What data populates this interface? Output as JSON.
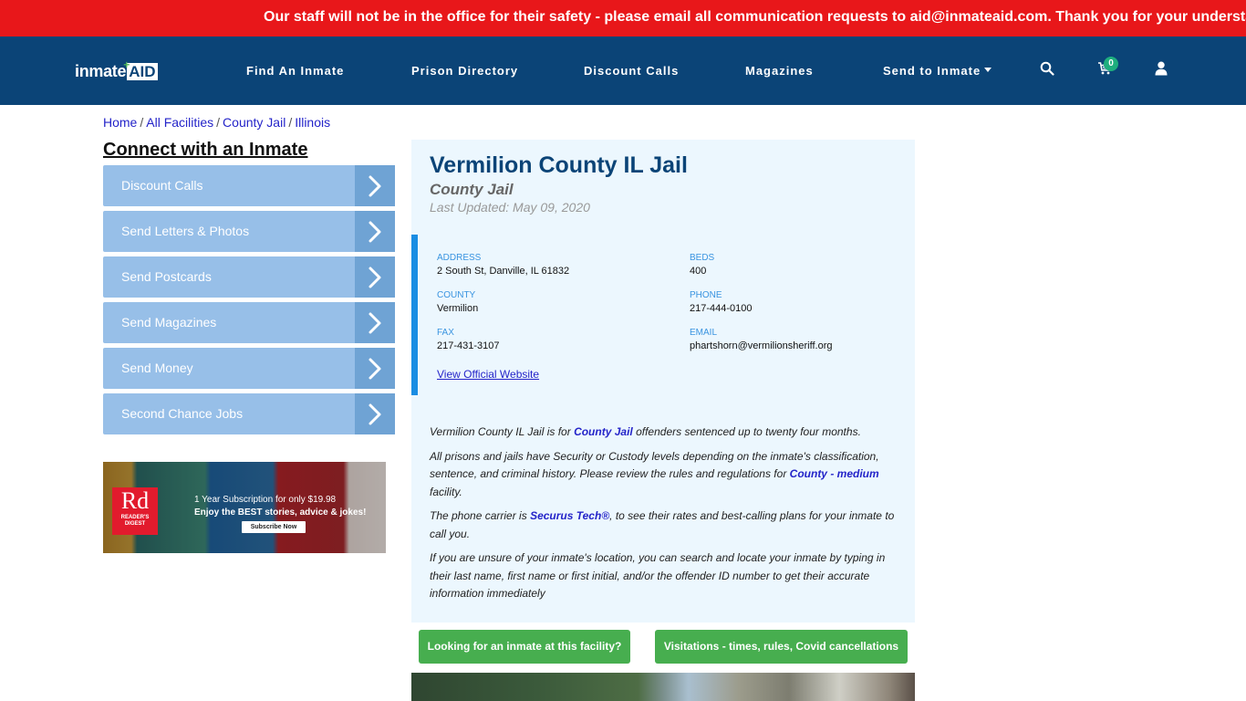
{
  "alert": {
    "text": "Our staff will not be in the office for their safety - please email all communication requests to aid@inmateaid.com. Thank you for your understanding."
  },
  "navbar": {
    "logo": {
      "prefix": "inmate",
      "suffix": "AID",
      "plus": "+"
    },
    "items": [
      {
        "label": "Find An Inmate"
      },
      {
        "label": "Prison Directory"
      },
      {
        "label": "Discount Calls"
      },
      {
        "label": "Magazines"
      },
      {
        "label": "Send to Inmate",
        "has_dropdown": true
      }
    ],
    "icons": [
      "search-icon",
      "cart-icon",
      "user-icon"
    ],
    "cart_count": "0"
  },
  "breadcrumb": [
    {
      "label": "Home"
    },
    {
      "label": "All Facilities"
    },
    {
      "label": "County Jail"
    },
    {
      "label": "Illinois"
    }
  ],
  "sidebar": {
    "title": "Connect with an Inmate",
    "items": [
      {
        "label": "Discount Calls"
      },
      {
        "label": "Send Letters & Photos"
      },
      {
        "label": "Send Postcards"
      },
      {
        "label": "Send Magazines"
      },
      {
        "label": "Send Money"
      },
      {
        "label": "Second Chance Jobs"
      }
    ],
    "ad": {
      "brand_big": "Rd",
      "brand_small_1": "READER'S",
      "brand_small_2": "DIGEST",
      "line1": "1 Year Subscription for only $19.98",
      "line2": "Enjoy the BEST stories, advice & jokes!",
      "button": "Subscribe Now"
    }
  },
  "facility": {
    "name": "Vermilion County IL Jail",
    "type": "County Jail",
    "last_updated": "Last Updated: May 09, 2020",
    "fields": {
      "address": {
        "label": "ADDRESS",
        "value": "2 South St, Danville, IL 61832"
      },
      "beds": {
        "label": "BEDS",
        "value": "400"
      },
      "county": {
        "label": "COUNTY",
        "value": "Vermilion"
      },
      "phone": {
        "label": "PHONE",
        "value": "217-444-0100"
      },
      "fax": {
        "label": "FAX",
        "value": "217-431-3107"
      },
      "email": {
        "label": "EMAIL",
        "value": "phartshorn@vermilionsheriff.org"
      }
    },
    "website_link": "View Official Website",
    "description": {
      "p1": {
        "before": "Vermilion County IL Jail is for ",
        "link": "County Jail",
        "after": " offenders sentenced up to twenty four months."
      },
      "p2": {
        "before": "All prisons and jails have Security or Custody levels depending on the inmate's classification, sentence, and criminal history. Please review the rules and regulations for ",
        "link": "County - medium",
        "after": " facility."
      },
      "p3": {
        "before": "The phone carrier is ",
        "link": "Securus Tech®",
        "after": ", to see their rates and best-calling plans for your inmate to call you."
      },
      "p4": {
        "text": "If you are unsure of your inmate's location, you can search and locate your inmate by typing in their last name, first name or first initial, and/or the offender ID number to get their accurate information immediately"
      }
    }
  },
  "actions": {
    "find_inmate": "Looking for an inmate at this facility?",
    "visitations": "Visitations - times, rules, Covid cancellations"
  }
}
